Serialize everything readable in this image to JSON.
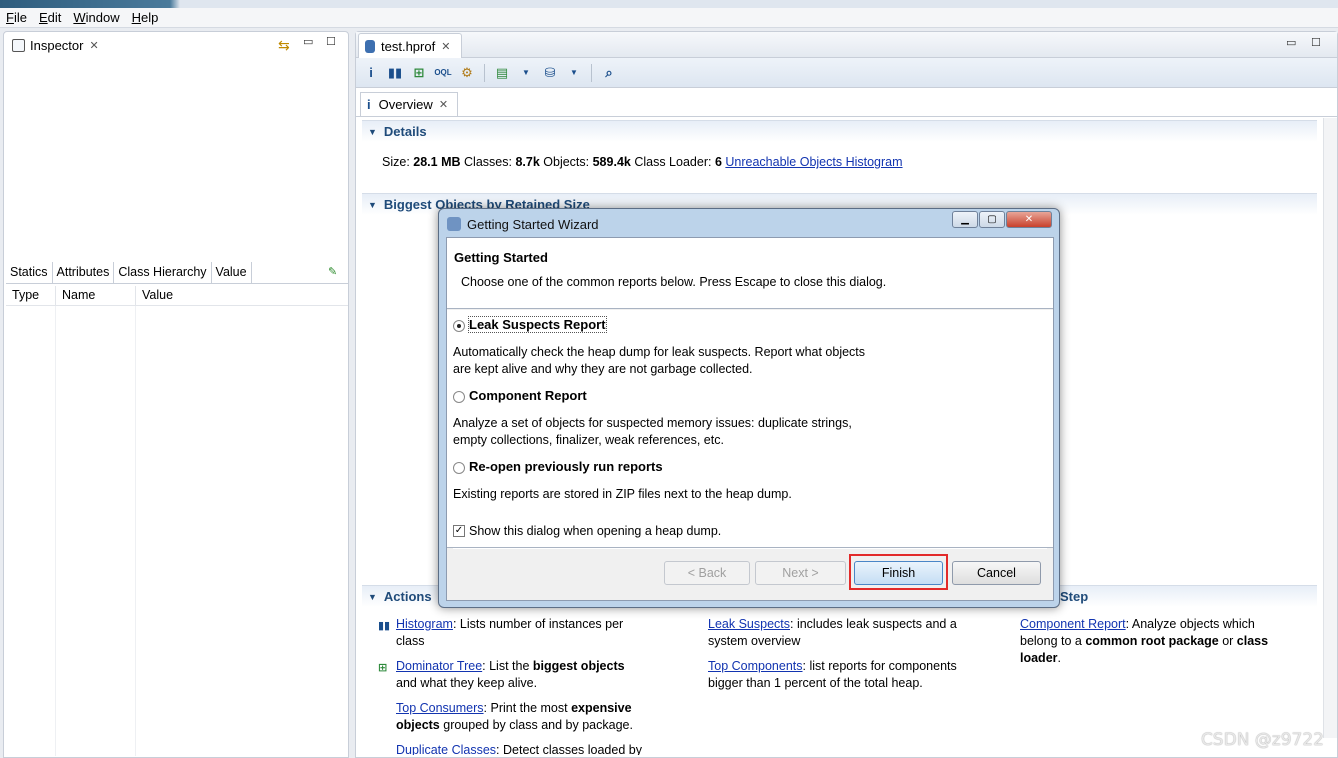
{
  "menu": [
    "File",
    "Edit",
    "Window",
    "Help"
  ],
  "inspector": {
    "title": "Inspector",
    "subtabs": [
      "Statics",
      "Attributes",
      "Class Hierarchy",
      "Value"
    ],
    "columns": [
      "Type",
      "Name",
      "Value"
    ]
  },
  "editor": {
    "tab": "test.hprof",
    "inner_tab": "Overview",
    "details": {
      "heading": "Details",
      "size_label": "Size:",
      "size": "28.1 MB",
      "classes_label": "Classes:",
      "classes": "8.7k",
      "objects_label": "Objects:",
      "objects": "589.4k",
      "loader_label": "Class Loader:",
      "loader": "6",
      "link": "Unreachable Objects Histogram"
    },
    "biggest_heading": "Biggest Objects by Retained Size",
    "actions": {
      "heading": "Actions",
      "step_heading_tail": "Step",
      "col1": [
        {
          "link": "Histogram",
          "pre": ": Lists number of instances per class"
        },
        {
          "link": "Dominator Tree",
          "pre": ": List the ",
          "bold": "biggest objects",
          "post": " and what they keep alive."
        },
        {
          "link": "Top Consumers",
          "pre": ": Print the most ",
          "bold": "expensive objects",
          "post": " grouped by class and by package."
        },
        {
          "link": "Duplicate Classes",
          "pre": ": Detect classes loaded by"
        }
      ],
      "col2": [
        {
          "link": "Leak Suspects",
          "pre": ": includes leak suspects and a system overview"
        },
        {
          "link": "Top Components",
          "pre": ": list reports for components bigger than 1 percent of the total heap."
        }
      ],
      "col3": [
        {
          "link": "Component Report",
          "pre": ": Analyze objects which belong to a ",
          "bold": "common root package",
          "mid": " or ",
          "bold2": "class loader",
          "post": "."
        }
      ]
    }
  },
  "dialog": {
    "title": "Getting Started Wizard",
    "header_title": "Getting Started",
    "header_desc": "Choose one of the common reports below. Press Escape to close this dialog.",
    "options": [
      {
        "label": "Leak Suspects Report",
        "selected": true,
        "desc1": "Automatically check the heap dump for leak suspects. Report what objects",
        "desc2": "are kept alive and why they are not garbage collected."
      },
      {
        "label": "Component Report",
        "selected": false,
        "desc1": "Analyze a set of objects for suspected memory issues: duplicate strings,",
        "desc2": "empty collections, finalizer, weak references, etc."
      },
      {
        "label": "Re-open previously run reports",
        "selected": false,
        "desc1": "Existing reports are stored in ZIP files next to the heap dump.",
        "desc2": ""
      }
    ],
    "checkbox_label": "Show this dialog when opening a heap dump.",
    "checkbox_checked": true,
    "buttons": {
      "back": "< Back",
      "next": "Next >",
      "finish": "Finish",
      "cancel": "Cancel"
    },
    "highlight_color": "#e22a2a"
  },
  "watermark": "CSDN @z9722"
}
